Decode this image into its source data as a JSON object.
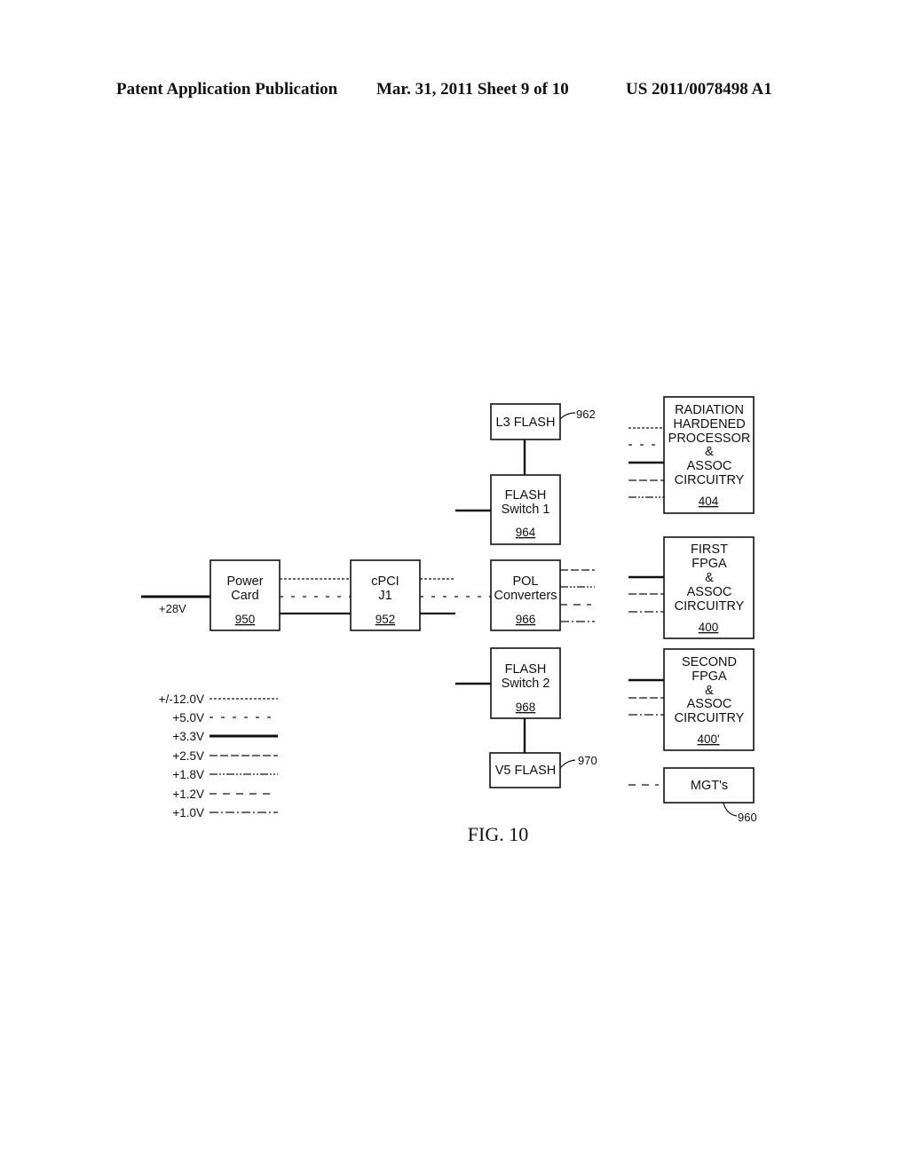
{
  "header": {
    "left": "Patent Application Publication",
    "center": "Mar. 31, 2011  Sheet 9 of 10",
    "right": "US 2011/0078498 A1"
  },
  "figure_label": "FIG. 10",
  "input_label": "+28V",
  "blocks": {
    "power_card": {
      "line1": "Power",
      "line2": "Card",
      "ref": "950"
    },
    "cpci": {
      "line1": "cPCI",
      "line2": "J1",
      "ref": "952"
    },
    "l3_flash": {
      "label": "L3 FLASH",
      "ref": "962"
    },
    "flash_switch_1": {
      "line1": "FLASH",
      "line2": "Switch 1",
      "ref": "964"
    },
    "pol": {
      "line1": "POL",
      "line2": "Converters",
      "ref": "966"
    },
    "flash_switch_2": {
      "line1": "FLASH",
      "line2": "Switch 2",
      "ref": "968"
    },
    "v5_flash": {
      "label": "V5 FLASH",
      "ref": "970"
    },
    "rad_proc": {
      "lines": [
        "RADIATION",
        "HARDENED",
        "PROCESSOR",
        "&",
        "ASSOC",
        "CIRCUITRY"
      ],
      "ref": "404"
    },
    "first_fpga": {
      "lines": [
        "FIRST",
        "FPGA",
        "&",
        "ASSOC",
        "CIRCUITRY"
      ],
      "ref": "400"
    },
    "second_fpga": {
      "lines": [
        "SECOND",
        "FPGA",
        "&",
        "ASSOC",
        "CIRCUITRY"
      ],
      "ref": "400'"
    },
    "mgt": {
      "label": "MGT's",
      "ref": "960"
    }
  },
  "legend": [
    {
      "label": "+/-12.0V",
      "style": "fine-dotted"
    },
    {
      "label": "+5.0V",
      "style": "sparse-dashed"
    },
    {
      "label": "+3.3V",
      "style": "thick-solid"
    },
    {
      "label": "+2.5V",
      "style": "long-dashed"
    },
    {
      "label": "+1.8V",
      "style": "dash-dot-dot"
    },
    {
      "label": "+1.2V",
      "style": "medium-dashed"
    },
    {
      "label": "+1.0V",
      "style": "dash-dot"
    }
  ]
}
